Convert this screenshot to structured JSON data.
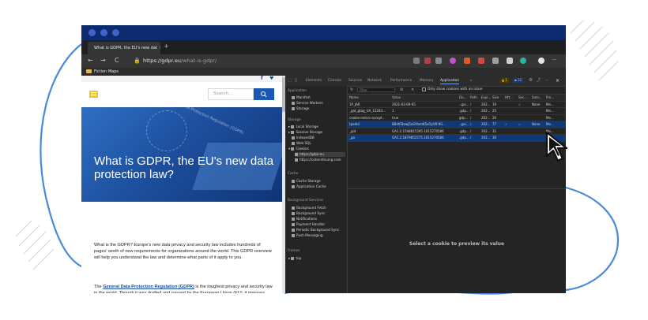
{
  "browser": {
    "tab_title": "What is GDPR, the EU's new dat",
    "tab_close": "×",
    "new_tab": "+",
    "nav": {
      "back": "←",
      "forward": "→",
      "reload": "C"
    },
    "url_host": "https://gdpr.eu",
    "url_path": "/what-is-gdpr/",
    "bookmark": "Fiction Maps",
    "menu": "···"
  },
  "page": {
    "social": [
      "f",
      "♥"
    ],
    "search_placeholder": "Search...",
    "hero_ribbon": "Data Protection Regulation (GDPR)",
    "hero_title": "What is GDPR, the EU's new data protection law?",
    "intro": "What is the GDPR? Europe's new data privacy and security law includes hundreds of pages' worth of new requirements for organizations around the world. This GDPR overview will help you understand the law and determine what parts of it apply to you.",
    "p2_pre": "The ",
    "p2_link": "General Data Protection Regulation (GDPR)",
    "p2_post": " is the toughest privacy and security law in the world. Though it was drafted and passed by the European Union (EU), it imposes obligations onto organizations anywhere, so long as they target or collect data related to people in the EU. The"
  },
  "devtools": {
    "tabs": [
      "Elements",
      "Console",
      "Sources",
      "Network",
      "Performance",
      "Memory",
      "Application"
    ],
    "more": "»",
    "badges": {
      "warnings": "▲ 1",
      "errors": "▪ 12"
    },
    "sidebar": {
      "application_header": "Application",
      "application_items": [
        "Manifest",
        "Service Workers",
        "Storage"
      ],
      "storage_header": "Storage",
      "storage_items": [
        "Local Storage",
        "Session Storage",
        "IndexedDB",
        "Web SQL",
        "Cookies"
      ],
      "cookie_sites": [
        "https://gdpr.eu",
        "https://cohenthiuing.com"
      ],
      "cache_header": "Cache",
      "cache_items": [
        "Cache Storage",
        "Application Cache"
      ],
      "bg_header": "Background Services",
      "bg_items": [
        "Background Fetch",
        "Background Sync",
        "Notifications",
        "Payment Handler",
        "Periodic Background Sync",
        "Push Messaging"
      ],
      "frames_header": "Frames",
      "frames_items": [
        "top"
      ]
    },
    "filter_placeholder": "Filter",
    "only_issue_label": "Only show cookies with an issue",
    "columns": [
      "Name",
      "Value",
      "Do...",
      "Path",
      "Expi...",
      "Size",
      "Htt...",
      "Sec...",
      "Sam...",
      "Pro..."
    ],
    "rows": [
      [
        "1P_JAR",
        "2021-03-09-05",
        "..goi...",
        "/",
        "202...",
        "19",
        "",
        "✓",
        "None",
        "Me..."
      ],
      [
        "_gat_gtag_UA_12283...",
        "1",
        ".gdp...",
        "/",
        "202...",
        "25",
        "",
        "",
        "",
        "Me..."
      ],
      [
        "cookie-notice-accept...",
        "true",
        "gdp...",
        "/",
        "202...",
        "26",
        "",
        "",
        "",
        "Me..."
      ],
      [
        "tpedid",
        "8BdtFBewJ5xGfrbmK5vOyVR-9G...",
        "..goi...",
        "/",
        "202...",
        "77",
        "✓",
        "✓",
        "None",
        "Me..."
      ],
      [
        "_gid",
        "GA1.2.1598815395.1615270586",
        ".gdp...",
        "/",
        "202...",
        "31",
        "",
        "",
        "",
        "Me..."
      ],
      [
        "_ga",
        "GA1.2.1879852575.1615270586",
        ".gdp...",
        "/",
        "202...",
        "30",
        "",
        "",
        "",
        "Me..."
      ]
    ],
    "preview_text": "Select a cookie to preview its value"
  },
  "colors": {
    "titlebar": "#0e2a6e",
    "accent_blue": "#1a58b3",
    "accent_yellow": "#e8c532",
    "deco_line": "#4a8ad8"
  }
}
